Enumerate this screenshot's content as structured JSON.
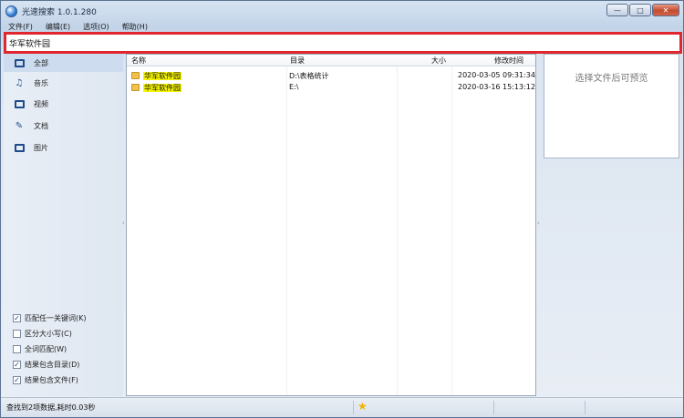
{
  "window": {
    "title": "光速搜索 1.0.1.280"
  },
  "controls": {
    "minimize": "—",
    "maximize": "□",
    "close": "✕"
  },
  "menu": [
    "文件(F)",
    "编辑(E)",
    "选项(O)",
    "帮助(H)"
  ],
  "search": {
    "value": "华军软件园"
  },
  "sidebar": {
    "items": [
      {
        "label": "全部",
        "icon": "all-icon"
      },
      {
        "label": "音乐",
        "icon": "music-icon"
      },
      {
        "label": "视频",
        "icon": "video-icon"
      },
      {
        "label": "文档",
        "icon": "document-icon"
      },
      {
        "label": "图片",
        "icon": "image-icon"
      }
    ],
    "options": [
      {
        "label": "匹配任一关键词(K)",
        "checked": true
      },
      {
        "label": "区分大小写(C)",
        "checked": false
      },
      {
        "label": "全词匹配(W)",
        "checked": false
      },
      {
        "label": "结果包含目录(D)",
        "checked": true
      },
      {
        "label": "结果包含文件(F)",
        "checked": true
      }
    ]
  },
  "table": {
    "headers": {
      "name": "名称",
      "dir": "目录",
      "size": "大小",
      "modified": "修改时间"
    },
    "rows": [
      {
        "name": "华军软件园",
        "dir": "D:\\表格统计",
        "size": "",
        "modified": "2020-03-05 09:31:34"
      },
      {
        "name": "华军软件园",
        "dir": "E:\\",
        "size": "",
        "modified": "2020-03-16 15:13:12"
      }
    ]
  },
  "preview": {
    "text": "选择文件后可预览"
  },
  "status": {
    "text": "查找到2项数据,耗时0.03秒"
  }
}
